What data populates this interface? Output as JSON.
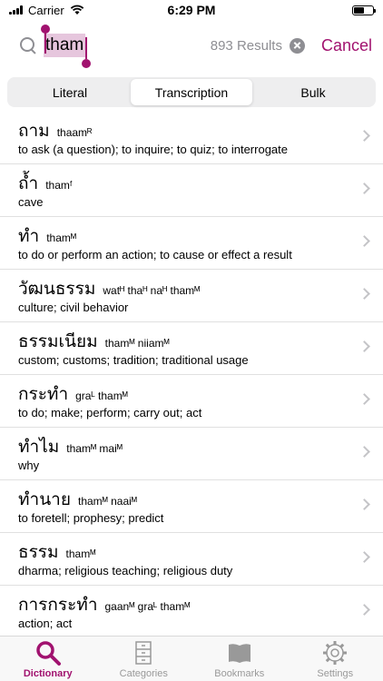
{
  "status_bar": {
    "carrier": "Carrier",
    "time": "6:29 PM"
  },
  "search": {
    "query": "tham",
    "results": "893 Results",
    "cancel_label": "Cancel"
  },
  "segments": [
    {
      "label": "Literal",
      "active": false
    },
    {
      "label": "Transcription",
      "active": true
    },
    {
      "label": "Bulk",
      "active": false
    }
  ],
  "entries": [
    {
      "thai": "ถาม",
      "transcription": "thaamᴿ",
      "definition": "to ask (a question); to inquire; to quiz; to interrogate"
    },
    {
      "thai": "ถ้ำ",
      "transcription": "thamᶠ",
      "definition": "cave"
    },
    {
      "thai": "ทำ",
      "transcription": "thamᴹ",
      "definition": "to do or perform an action; to cause or effect a result"
    },
    {
      "thai": "วัฒนธรรม",
      "transcription": "watᴴ thaᴴ naᴴ thamᴹ",
      "definition": "culture; civil behavior"
    },
    {
      "thai": "ธรรมเนียม",
      "transcription": "thamᴹ niiamᴹ",
      "definition": "custom; customs; tradition; traditional usage"
    },
    {
      "thai": "กระทำ",
      "transcription": "graᴸ thamᴹ",
      "definition": "to do; make; perform; carry out; act"
    },
    {
      "thai": "ทำไม",
      "transcription": "thamᴹ maiᴹ",
      "definition": "why"
    },
    {
      "thai": "ทำนาย",
      "transcription": "thamᴹ naaiᴹ",
      "definition": "to foretell; prophesy; predict"
    },
    {
      "thai": "ธรรม",
      "transcription": "thamᴹ",
      "definition": "dharma; religious teaching; religious duty"
    },
    {
      "thai": "การกระทำ",
      "transcription": "gaanᴹ graᴸ thamᴹ",
      "definition": "action; act"
    }
  ],
  "tabs": [
    {
      "label": "Dictionary",
      "icon": "magnifier-icon",
      "active": true
    },
    {
      "label": "Categories",
      "icon": "cabinet-icon",
      "active": false
    },
    {
      "label": "Bookmarks",
      "icon": "book-icon",
      "active": false
    },
    {
      "label": "Settings",
      "icon": "gear-icon",
      "active": false
    }
  ],
  "colors": {
    "accent": "#a1126f",
    "inactive": "#999999"
  }
}
